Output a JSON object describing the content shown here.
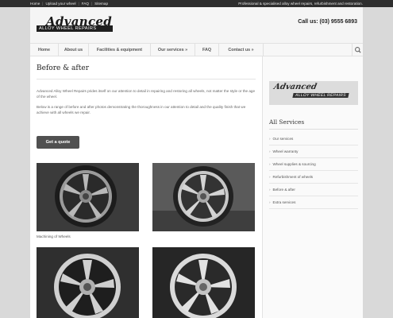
{
  "topbar": {
    "links": [
      "Home",
      "Upload your wheel",
      "FAQ",
      "Sitemap"
    ],
    "separator": "|",
    "tagline": "Professional & specialised alloy wheel repairs, refurbishment and restoration."
  },
  "header": {
    "logo_title": "Advanced",
    "logo_subtitle": "ALLOY WHEEL REPAIRS",
    "call_us": "Call us: (03) 9555 6893"
  },
  "nav": {
    "items": [
      "Home",
      "About us",
      "Facilities & equipment",
      "Our services »",
      "FAQ",
      "Contact us »"
    ],
    "search_icon": "search-icon"
  },
  "main": {
    "title": "Before & after",
    "para1": "Advanced Alloy Wheel Repairs prides itself on our attention to detail in repairing and restoring all wheels, not matter the style or the age of the wheel.",
    "para2": "Below is a range of before and after photos demonstrating the thoroughness in our attention to detail and the quality finish that we achieve with all wheels we repair.",
    "quote_button": "Get a quote",
    "caption1": "Machining of Wheels"
  },
  "sidebar": {
    "banner_title": "Advanced",
    "banner_subtitle": "ALLOY WHEEL REPAIRS",
    "title": "All Services",
    "bullet": "›",
    "items": [
      "Our services",
      "Wheel warranty",
      "Wheel supplies & sourcing",
      "Refurbishment of wheels",
      "Before & after",
      "Extra services"
    ]
  },
  "colors": {
    "topbar": "#2e2e2e",
    "button": "#505050",
    "page_bg": "#d9d9d9"
  }
}
